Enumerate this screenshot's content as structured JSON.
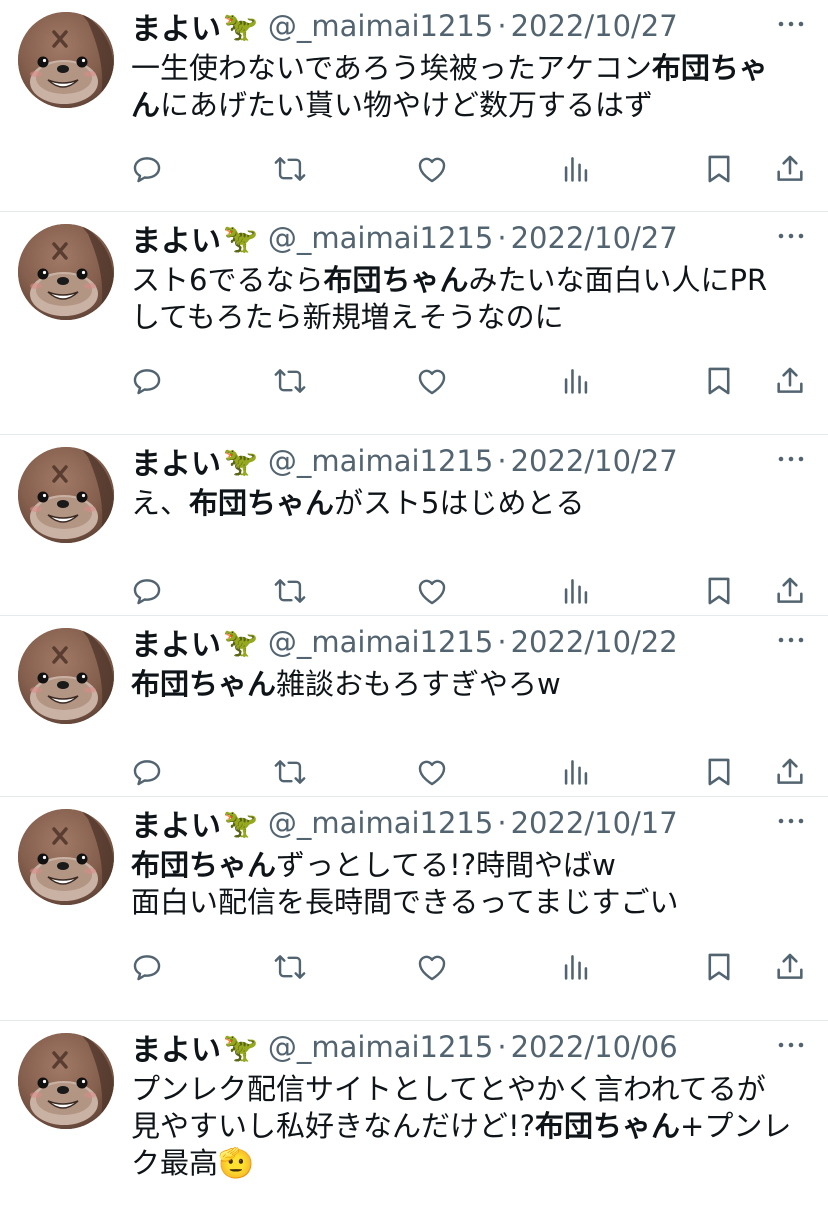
{
  "tweets": [
    {
      "name": "まよい",
      "name_emoji": "🦖",
      "handle": "@_maimai1215",
      "separator": "·",
      "date": "2022/10/27",
      "lines": [
        [
          {
            "t": "一生使わないであろう埃被ったアケコン"
          },
          {
            "t": "布団ち",
            "b": true
          },
          {
            "t": "ゃ",
            "b": true
          }
        ],
        [
          {
            "t": "ん",
            "b": true
          },
          {
            "t": "にあげたい貰い物やけど数万するはず"
          }
        ]
      ]
    },
    {
      "name": "まよい",
      "name_emoji": "🦖",
      "handle": "@_maimai1215",
      "separator": "·",
      "date": "2022/10/27",
      "lines": [
        [
          {
            "t": "スト6でるなら"
          },
          {
            "t": "布団ちゃん",
            "b": true
          },
          {
            "t": "みたいな面白い人にPR"
          }
        ],
        [
          {
            "t": "してもろたら新規増えそうなのに"
          }
        ]
      ]
    },
    {
      "name": "まよい",
      "name_emoji": "🦖",
      "handle": "@_maimai1215",
      "separator": "·",
      "date": "2022/10/27",
      "lines": [
        [
          {
            "t": "え、"
          },
          {
            "t": "布団ちゃん",
            "b": true
          },
          {
            "t": "がスト5はじめとる"
          }
        ]
      ]
    },
    {
      "name": "まよい",
      "name_emoji": "🦖",
      "handle": "@_maimai1215",
      "separator": "·",
      "date": "2022/10/22",
      "lines": [
        [
          {
            "t": "布団ちゃん",
            "b": true
          },
          {
            "t": "雑談おもろすぎやろw"
          }
        ]
      ]
    },
    {
      "name": "まよい",
      "name_emoji": "🦖",
      "handle": "@_maimai1215",
      "separator": "·",
      "date": "2022/10/17",
      "lines": [
        [
          {
            "t": "布団ちゃん",
            "b": true
          },
          {
            "t": "ずっとしてる!?時間やばw"
          }
        ],
        [
          {
            "t": "面白い配信を長時間できるってまじすごい"
          }
        ]
      ]
    },
    {
      "name": "まよい",
      "name_emoji": "🦖",
      "handle": "@_maimai1215",
      "separator": "·",
      "date": "2022/10/06",
      "lines": [
        [
          {
            "t": "プンレク配信サイトとしてとやかく言われてるが"
          }
        ],
        [
          {
            "t": "見やすいし私好きなんだけど!?"
          },
          {
            "t": "布団ちゃん",
            "b": true
          },
          {
            "t": "+プンレ"
          }
        ],
        [
          {
            "t": "ク最高"
          },
          {
            "t": "🫡"
          }
        ]
      ]
    }
  ],
  "action_icons": [
    "reply-icon",
    "retweet-icon",
    "like-icon",
    "views-icon",
    "bookmark-icon",
    "share-icon"
  ],
  "colors": {
    "text": "#0f1419",
    "secondary": "#536471",
    "divider": "#e6e9ec",
    "background": "#ffffff"
  }
}
